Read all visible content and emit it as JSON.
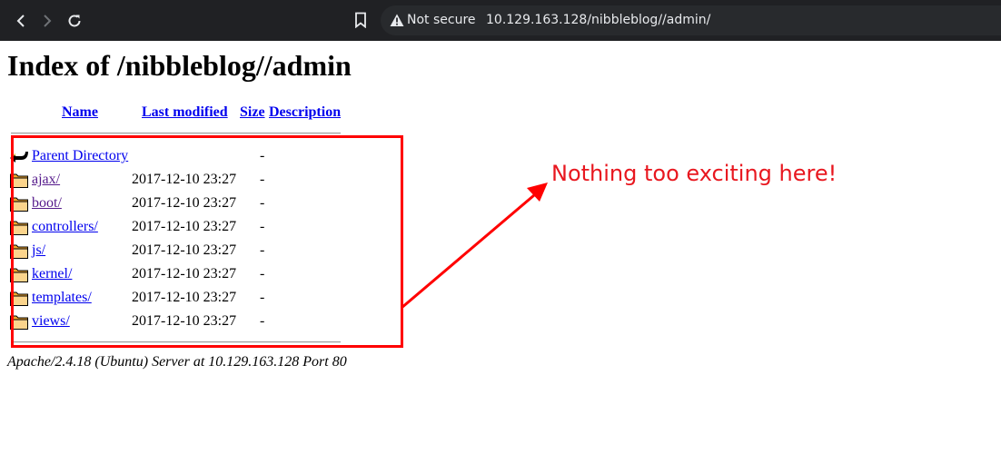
{
  "browser": {
    "back_icon": "chevron-left-icon",
    "forward_icon": "chevron-right-icon",
    "reload_icon": "reload-icon",
    "bookmark_icon": "bookmark-icon",
    "security_icon": "warning-triangle-icon",
    "security_label": "Not secure",
    "url": "10.129.163.128/nibbleblog//admin/"
  },
  "page": {
    "title": "Index of /nibbleblog//admin",
    "columns": {
      "name": "Name",
      "last_modified": "Last modified",
      "size": "Size",
      "description": "Description"
    },
    "parent": {
      "label": "Parent Directory",
      "size": "-"
    },
    "entries": [
      {
        "name": "ajax/",
        "modified": "2017-12-10 23:27",
        "size": "-"
      },
      {
        "name": "boot/",
        "modified": "2017-12-10 23:27",
        "size": "-"
      },
      {
        "name": "controllers/",
        "modified": "2017-12-10 23:27",
        "size": "-"
      },
      {
        "name": "js/",
        "modified": "2017-12-10 23:27",
        "size": "-"
      },
      {
        "name": "kernel/",
        "modified": "2017-12-10 23:27",
        "size": "-"
      },
      {
        "name": "templates/",
        "modified": "2017-12-10 23:27",
        "size": "-"
      },
      {
        "name": "views/",
        "modified": "2017-12-10 23:27",
        "size": "-"
      }
    ],
    "footer": "Apache/2.4.18 (Ubuntu) Server at 10.129.163.128 Port 80"
  },
  "annotation": {
    "text": "Nothing too exciting here!",
    "color": "#e8171f"
  }
}
